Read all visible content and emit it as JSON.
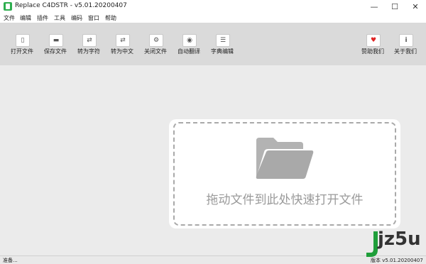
{
  "window": {
    "title": "Replace C4DSTR - v5.01.20200407",
    "minimize_glyph": "—",
    "maximize_glyph": "☐",
    "close_glyph": "✕"
  },
  "menu": [
    "文件",
    "编辑",
    "插件",
    "工具",
    "编码",
    "窗口",
    "帮助"
  ],
  "toolbar": {
    "open": {
      "label": "打开文件",
      "icon": "file-icon"
    },
    "save": {
      "label": "保存文件",
      "icon": "save-icon"
    },
    "to_string": {
      "label": "转为字符",
      "icon": "convert-icon"
    },
    "to_chinese": {
      "label": "转为中文",
      "icon": "convert-icon"
    },
    "close": {
      "label": "关闭文件",
      "icon": "gear-icon"
    },
    "auto_translate": {
      "label": "自动翻译",
      "icon": "translate-icon"
    },
    "dictionary": {
      "label": "字典编辑",
      "icon": "document-icon"
    },
    "donate": {
      "label": "赞助我们",
      "icon": "heart-icon",
      "color": "#e02424"
    },
    "about": {
      "label": "关于我们",
      "icon": "info-icon"
    }
  },
  "drop_zone": {
    "text": "拖动文件到此处快速打开文件",
    "icon": "folder-icon"
  },
  "status": {
    "left": "准备...",
    "right": "版本 v5.01.20200407"
  },
  "watermark": {
    "text": "jz5u"
  },
  "colors": {
    "app_icon": "#2eae4f",
    "toolbar_bg": "#dadada",
    "main_bg": "#ebebeb",
    "watermark_green": "#1f9e3a"
  }
}
